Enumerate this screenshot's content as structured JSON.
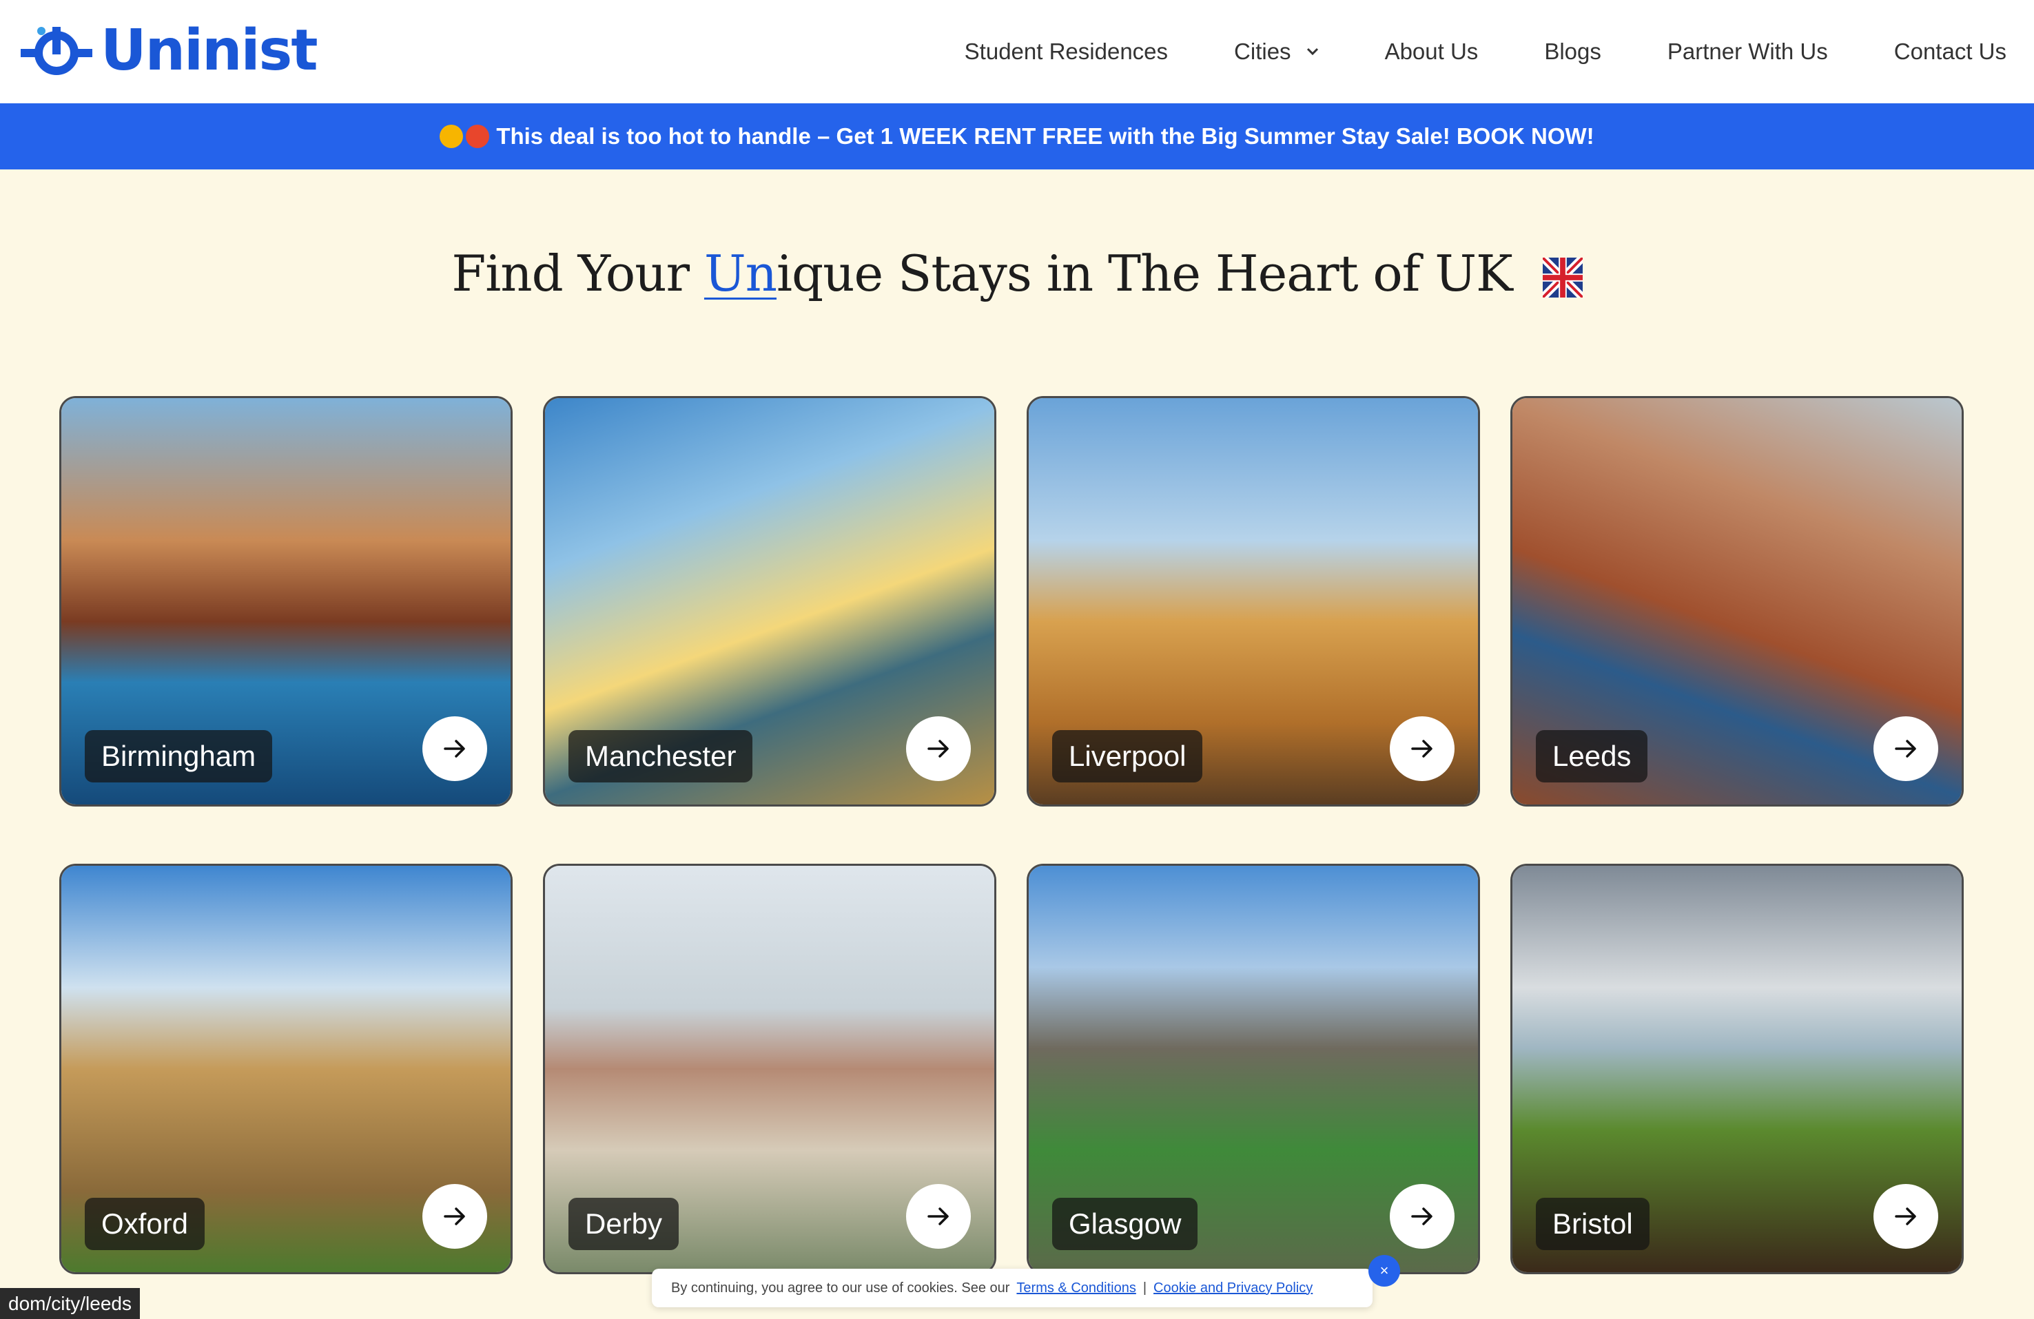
{
  "header": {
    "logo_text": "Uninist",
    "nav": [
      {
        "label": "Student Residences"
      },
      {
        "label": "Cities"
      },
      {
        "label": "About Us"
      },
      {
        "label": "Blogs"
      },
      {
        "label": "Partner With Us"
      },
      {
        "label": "Contact Us"
      }
    ]
  },
  "banner": {
    "text": "This deal is too hot to handle – Get 1 WEEK RENT FREE with the Big Summer Stay Sale! BOOK NOW!"
  },
  "hero": {
    "heading_before": "Find Your ",
    "heading_highlight": "Un",
    "heading_after": "ique Stays in The Heart of UK"
  },
  "cities": [
    {
      "name": "Birmingham"
    },
    {
      "name": "Manchester"
    },
    {
      "name": "Liverpool"
    },
    {
      "name": "Leeds"
    },
    {
      "name": "Oxford"
    },
    {
      "name": "Derby"
    },
    {
      "name": "Glasgow"
    },
    {
      "name": "Bristol"
    }
  ],
  "cookie": {
    "text": "By continuing, you agree to our use of cookies. See our",
    "terms_link": "Terms & Conditions",
    "separator": "|",
    "privacy_link": "Cookie and Privacy Policy",
    "close": "×"
  },
  "status_url": "dom/city/leeds",
  "colors": {
    "brand": "#1a57d6",
    "banner": "#2563eb",
    "page_bg": "#fdf8e4"
  }
}
